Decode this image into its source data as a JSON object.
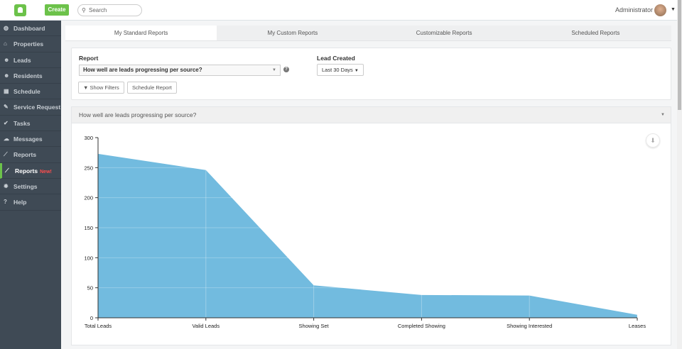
{
  "topbar": {
    "create_label": "Create",
    "search_placeholder": "Search",
    "user_name": "Administrator"
  },
  "sidebar": {
    "items": [
      {
        "label": "Dashboard",
        "icon": "dashboard-icon"
      },
      {
        "label": "Properties",
        "icon": "home-icon"
      },
      {
        "label": "Leads",
        "icon": "users-icon"
      },
      {
        "label": "Residents",
        "icon": "users-icon"
      },
      {
        "label": "Schedule",
        "icon": "calendar-icon"
      },
      {
        "label": "Service Request",
        "icon": "wrench-icon"
      },
      {
        "label": "Tasks",
        "icon": "check-icon"
      },
      {
        "label": "Messages",
        "icon": "comments-icon"
      },
      {
        "label": "Reports",
        "icon": "line-chart-icon"
      },
      {
        "label": "Reports",
        "icon": "line-chart-icon",
        "badge": "New!"
      },
      {
        "label": "Settings",
        "icon": "gear-icon"
      },
      {
        "label": "Help",
        "icon": "question-icon"
      }
    ]
  },
  "tabs": [
    "My Standard Reports",
    "My Custom Reports",
    "Customizable Reports",
    "Scheduled Reports"
  ],
  "report": {
    "report_label": "Report",
    "report_value": "How well are leads progressing per source?",
    "lead_created_label": "Lead Created",
    "lead_created_value": "Last 30 Days",
    "show_filters": "Show Filters",
    "schedule_report": "Schedule Report"
  },
  "chart_panel": {
    "title": "How well are leads progressing per source?"
  },
  "chart_data": {
    "type": "area",
    "categories": [
      "Total Leads",
      "Valid Leads",
      "Showing Set",
      "Completed Showing",
      "Showing Interested",
      "Leases"
    ],
    "values": [
      273,
      246,
      54,
      38,
      37,
      5
    ],
    "ylim": [
      0,
      300
    ],
    "yticks": [
      0,
      50,
      100,
      150,
      200,
      250,
      300
    ],
    "color": "#72bbdf",
    "grid": true
  }
}
